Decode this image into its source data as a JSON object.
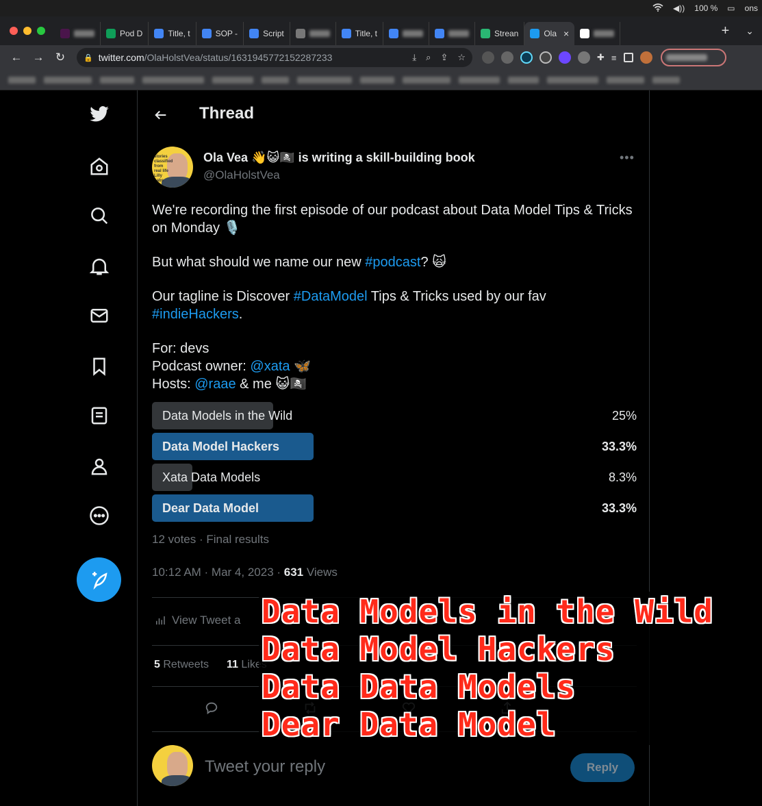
{
  "menubar": {
    "battery": "100 %",
    "clock_fragment": "ons"
  },
  "browser": {
    "tabs": [
      {
        "label": "",
        "icon": "slack-icon",
        "color": "#4a154b"
      },
      {
        "label": "Pod D",
        "icon": "sheets-icon",
        "color": "#0f9d58"
      },
      {
        "label": "Title, t",
        "icon": "docs-icon",
        "color": "#4285f4"
      },
      {
        "label": "SOP -",
        "icon": "docs-icon",
        "color": "#4285f4"
      },
      {
        "label": "Script",
        "icon": "docs-icon",
        "color": "#4285f4"
      },
      {
        "label": "",
        "icon": "globe-icon",
        "color": "#777777"
      },
      {
        "label": "Title, t",
        "icon": "docs-icon",
        "color": "#4285f4"
      },
      {
        "label": "",
        "icon": "docs-icon",
        "color": "#4285f4"
      },
      {
        "label": "",
        "icon": "docs-icon",
        "color": "#4285f4"
      },
      {
        "label": "Strean",
        "icon": "streamyard-icon",
        "color": "#2ab673"
      },
      {
        "label": "Ola",
        "icon": "twitter-icon",
        "color": "#1d9bf0",
        "active": true
      },
      {
        "label": "",
        "icon": "github-icon",
        "color": "#ffffff"
      }
    ],
    "url_host": "twitter.com",
    "url_path": "/OlaHolstVea/status/1631945772152287233"
  },
  "nav": {
    "items": [
      "home",
      "explore",
      "notifications",
      "messages",
      "bookmarks",
      "lists",
      "profile",
      "more"
    ]
  },
  "header": {
    "title": "Thread"
  },
  "tweet": {
    "author_name": "Ola Vea 👋😺🏴‍☠️ is writing a skill-building book",
    "handle": "@OlaHolstVea",
    "avatar_text": "stories classified from real life Lilly Labs",
    "line1": "We're recording the first episode of our podcast about Data Model Tips & Tricks on Monday 🎙️",
    "line2_pre": "But what should we name our new ",
    "line2_tag": "#podcast",
    "line2_post": "? 🙀",
    "line3_pre": "Our tagline is Discover ",
    "line3_tag1": "#DataModel",
    "line3_mid": " Tips & Tricks used by our fav ",
    "line3_tag2": "#indieHackers",
    "line3_post": ".",
    "for_line": "For: devs",
    "owner_pre": "Podcast owner: ",
    "owner_mention": "@xata",
    "owner_post": " 🦋",
    "hosts_pre": "Hosts: ",
    "hosts_mention": "@raae",
    "hosts_post": " & me 😺🏴‍☠️",
    "poll": [
      {
        "label": "Data Models in the Wild",
        "percent_label": "25%",
        "percent": 25,
        "winner": false
      },
      {
        "label": "Data Model Hackers",
        "percent_label": "33.3%",
        "percent": 33.3,
        "winner": true
      },
      {
        "label": "Xata Data Models",
        "percent_label": "8.3%",
        "percent": 8.3,
        "winner": false
      },
      {
        "label": "Dear Data Model",
        "percent_label": "33.3%",
        "percent": 33.3,
        "winner": true
      }
    ],
    "poll_meta": "12 votes · Final results",
    "timestamp": "10:12 AM · Mar 4, 2023 · ",
    "views_count": "631",
    "views_label": " Views",
    "analytics_label": "View Tweet a",
    "retweets_count": "5",
    "retweets_label": " Retweets",
    "likes_count": "11",
    "likes_label": " Likes"
  },
  "reply": {
    "placeholder": "Tweet your reply",
    "button": "Reply"
  },
  "overlay": {
    "lines": [
      "Data Models in the Wild",
      "Data Model Hackers",
      "Data Data Models",
      "Dear Data Model"
    ]
  },
  "colors": {
    "accent": "#1d9bf0",
    "poll_winner": "#1a5a8e",
    "poll_other": "#333639",
    "overlay_text": "#ff2a1a"
  }
}
